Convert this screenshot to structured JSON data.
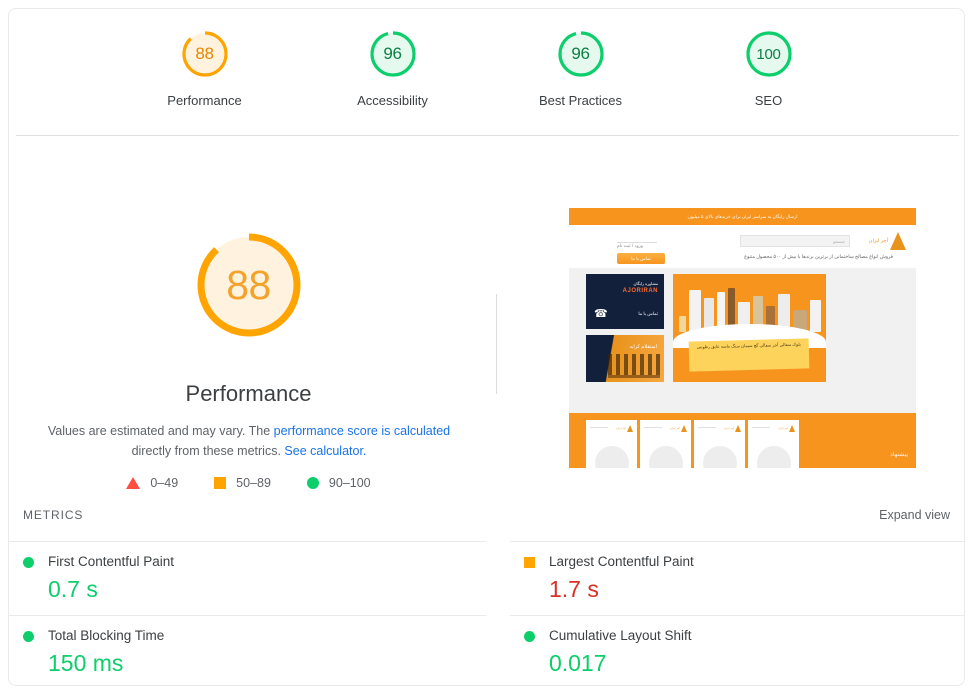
{
  "report": {
    "category_scores": [
      {
        "id": "performance",
        "value": 88,
        "label": "Performance",
        "color": "#ffa400",
        "fill": "#fff3e0"
      },
      {
        "id": "accessibility",
        "value": 96,
        "label": "Accessibility",
        "color": "#0cce6b",
        "fill": "#e6f9ef"
      },
      {
        "id": "best-practices",
        "value": 96,
        "label": "Best Practices",
        "color": "#0cce6b",
        "fill": "#e6f9ef"
      },
      {
        "id": "seo",
        "value": 100,
        "label": "SEO",
        "color": "#0cce6b",
        "fill": "#e6f9ef"
      }
    ],
    "hero": {
      "score": "88",
      "title": "Performance",
      "description_part1": "Values are estimated and may vary. The ",
      "link_score_calculated": "performance score is calculated",
      "description_part2": " directly from these metrics. ",
      "link_see_calculator": "See calculator."
    },
    "legend": [
      {
        "icon": "triangle",
        "range": "0–49",
        "color": "#ff4e42"
      },
      {
        "icon": "square",
        "range": "50–89",
        "color": "#ffa400"
      },
      {
        "icon": "circle",
        "range": "90–100",
        "color": "#0cce6b"
      }
    ],
    "metrics_section": {
      "title": "METRICS",
      "expand_view": "Expand view"
    },
    "metrics": [
      {
        "name": "First Contentful Paint",
        "value": "0.7 s",
        "icon": "circle",
        "color": "#0cce6b"
      },
      {
        "name": "Largest Contentful Paint",
        "value": "1.7 s",
        "icon": "square",
        "color": "#ffa400",
        "value_color": "#d93025"
      },
      {
        "name": "Total Blocking Time",
        "value": "150 ms",
        "icon": "circle",
        "color": "#0cce6b"
      },
      {
        "name": "Cumulative Layout Shift",
        "value": "0.017",
        "icon": "circle",
        "color": "#0cce6b"
      }
    ],
    "screenshot_preview": {
      "top_banner_text": "ارسال رایگان به سراسر ایران برای خریدهای بالای ۵ میلیون",
      "account_text": "ورود / ثبت نام",
      "search_placeholder": "جستجو",
      "cta_button": "تماس با ما",
      "tagline": "فروش انواع مصالح ساختمانی از برترین برندها با بیش از ۵۰۰ محصول متنوع",
      "brand_name": "آجر ایران",
      "card_a_small": "مشاوره رایگان",
      "card_a_brand": "AJORIRAN",
      "card_a_sub": "تماس با ما",
      "card_b_text": "استقلام کرایه",
      "note_text": "بلوک سفالی آجر سفالی گچ سیمان سنگ ماسه عایق رطوبتی",
      "bottom_brand": "پیشنهاد",
      "product_logo": "آجر ایران"
    }
  }
}
